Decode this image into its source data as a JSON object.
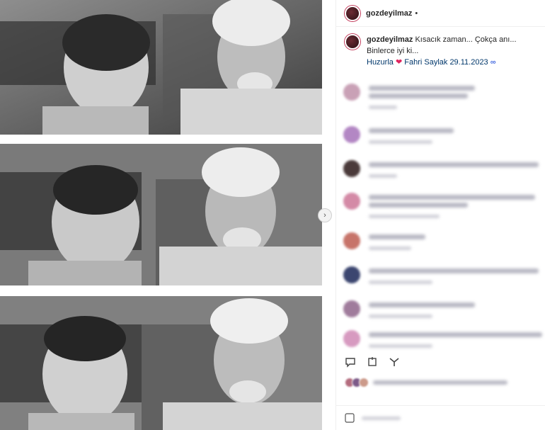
{
  "post": {
    "username": "gozdeyilmaz",
    "header_separator": "•",
    "caption_username": "gozdeyilmaz",
    "caption_text": "Kısacık zaman... Çokça anı... Binlerce iyi ki...",
    "caption_line2_prefix": "Huzurla",
    "caption_heart": "❤",
    "caption_line2_suffix": "Fahri Saylak 29.11.2023",
    "caption_infinity": "∞"
  },
  "media": {
    "next_arrow": "›",
    "photo_count": 3
  },
  "icons": {
    "next": "chevron-right-icon",
    "comment_action": "comment-icon",
    "share_action": "share-icon",
    "save_action": "bookmark-icon",
    "emoji": "emoji-icon"
  },
  "colors": {
    "accent_heart": "#e0245e",
    "link": "#00376b",
    "infinity": "#4a6ee0"
  },
  "comments": [
    {
      "avatar_color": "#c9a1b6"
    },
    {
      "avatar_color": "#b387c4"
    },
    {
      "avatar_color": "#4a3a3a"
    },
    {
      "avatar_color": "#d48aa6"
    },
    {
      "avatar_color": "#c7746a"
    },
    {
      "avatar_color": "#3c4670"
    },
    {
      "avatar_color": "#a07c9c"
    },
    {
      "avatar_color": "#d79ac0"
    }
  ]
}
